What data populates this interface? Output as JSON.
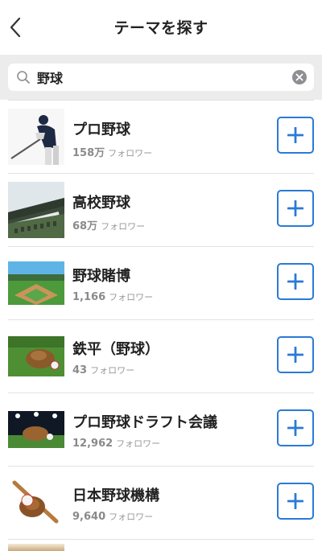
{
  "header": {
    "title": "テーマを探す",
    "back_icon": "chevron-left-icon"
  },
  "search": {
    "value": "野球",
    "search_icon": "search-icon",
    "clear_icon": "clear-circle-icon"
  },
  "colors": {
    "accent": "#2a7ad6",
    "band": "#ececec",
    "muted": "#999999"
  },
  "themes": [
    {
      "name": "プロ野球",
      "count": "158万",
      "unit": "フォロワー",
      "thumb": "batter"
    },
    {
      "name": "高校野球",
      "count": "68万",
      "unit": "フォロワー",
      "thumb": "koshien-stadium"
    },
    {
      "name": "野球賭博",
      "count": "1,166",
      "unit": "フォロワー",
      "thumb": "baseball-field"
    },
    {
      "name": "鉄平（野球）",
      "count": "43",
      "unit": "フォロワー",
      "thumb": "glove-on-grass"
    },
    {
      "name": "プロ野球ドラフト会議",
      "count": "12,962",
      "unit": "フォロワー",
      "thumb": "glove-night-lights"
    },
    {
      "name": "日本野球機構",
      "count": "9,640",
      "unit": "フォロワー",
      "thumb": "bat-glove-ball"
    }
  ]
}
